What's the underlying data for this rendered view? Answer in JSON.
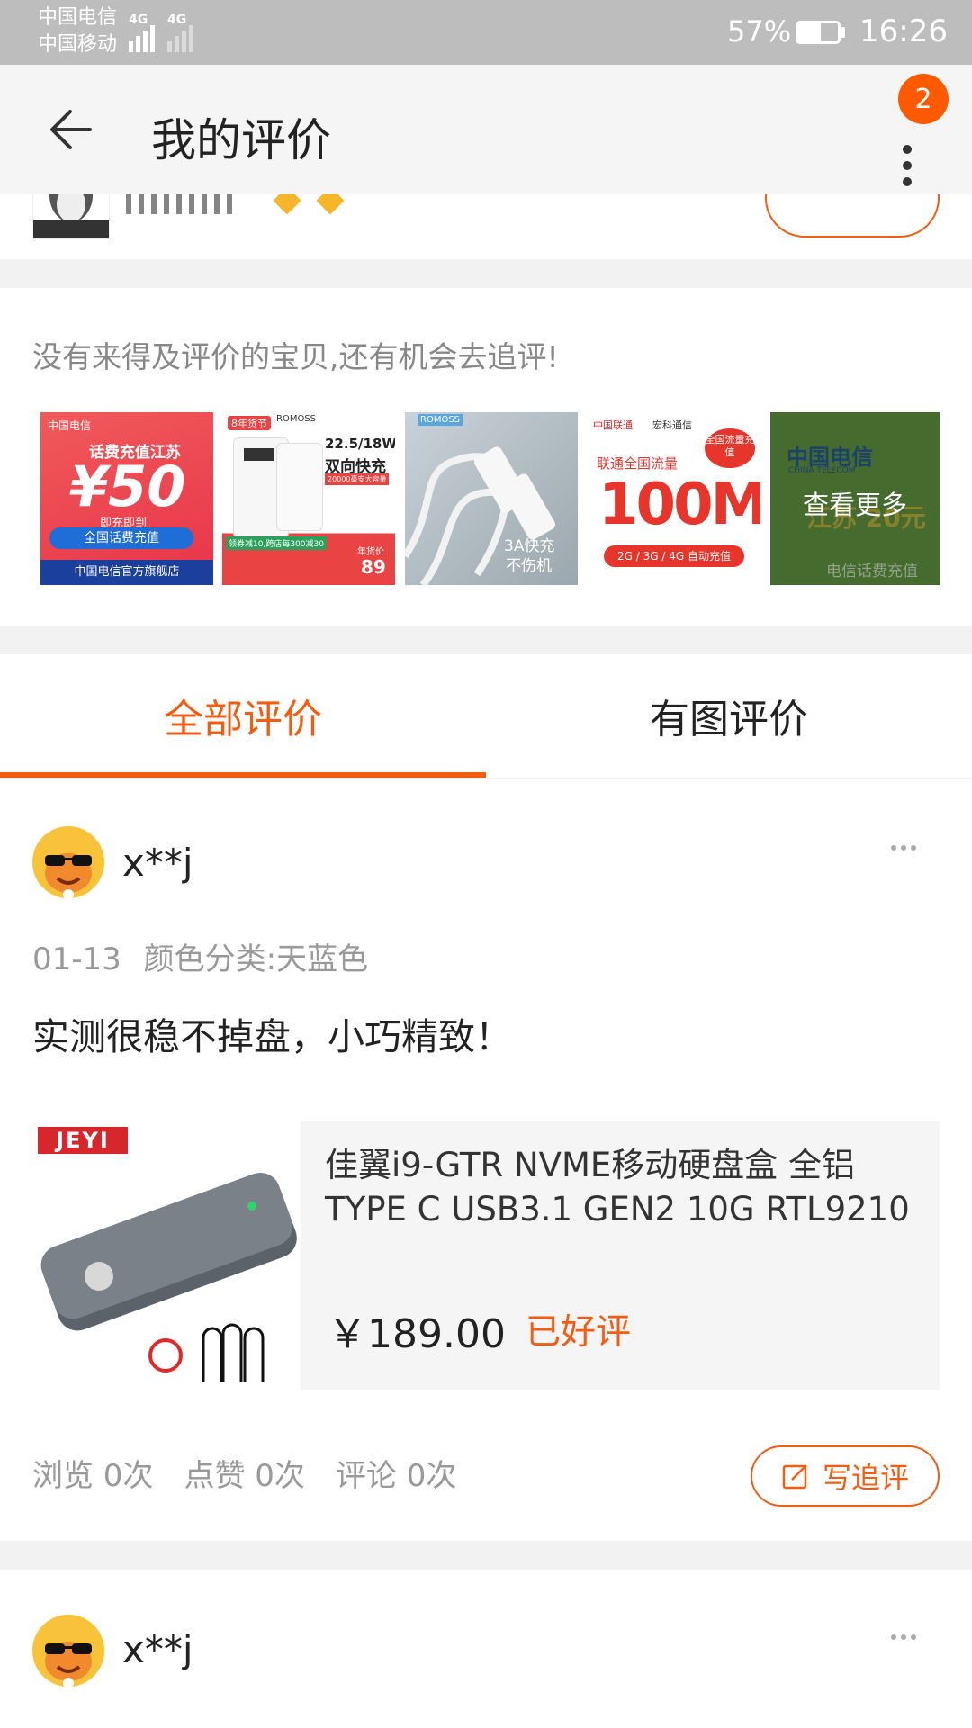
{
  "status_bar": {
    "carrier_1": "中国电信",
    "carrier_2": "中国移动",
    "network_1": "4G",
    "network_2": "4G",
    "battery": "57%",
    "battery_level": 0.57,
    "time": "16:26"
  },
  "header": {
    "title": "我的评价",
    "badge_count": "2"
  },
  "followup_section": {
    "prompt": "没有来得及评价的宝贝,还有机会去追评!",
    "view_more": "查看更多",
    "thumbnails": [
      {
        "lines": [
          "中国电信",
          "话费充值江苏",
          "¥50",
          "即充即到",
          "全国话费充值",
          "中国电信官方旗舰店"
        ]
      },
      {
        "lines": [
          "ROMOSS",
          "8年货节",
          "22.5/18W",
          "双向快充",
          "20000毫安大容量",
          "领券减10,跨店每300减30",
          "年货价",
          "89"
        ]
      },
      {
        "lines": [
          "ROMOSS",
          "3A快充",
          "不伤机"
        ]
      },
      {
        "lines": [
          "中国联通",
          "宏科通信",
          "全国流量充值",
          "联通全国流量",
          "100M",
          "2G / 3G / 4G 自动充值"
        ]
      },
      {
        "lines": [
          "中国电信",
          "CHINA TELECOM",
          "江苏 20元",
          "电信话费充值"
        ]
      }
    ]
  },
  "tabs": [
    {
      "label": "全部评价",
      "active": true
    },
    {
      "label": "有图评价",
      "active": false
    }
  ],
  "reviews": [
    {
      "user": "x**j",
      "date": "01-13",
      "sku": "颜色分类:天蓝色",
      "text": "实测很稳不掉盘，小巧精致！",
      "product": {
        "brand": "JEYI",
        "name_line1": "佳翼i9-GTR NVME移动硬盘盒 全铝",
        "name_line2": "TYPE C USB3.1 GEN2 10G RTL9210",
        "price": "￥189.00",
        "status": "已好评"
      },
      "stats": [
        "浏览 0次",
        "点赞 0次",
        "评论 0次"
      ],
      "followup_label": "写追评"
    },
    {
      "user": "x**j"
    }
  ],
  "colors": {
    "accent": "#f25d12",
    "status_bar": "#bdbdbd",
    "header": "#f5f5f5",
    "background": "#f2f2f2"
  },
  "icons": [
    "back-arrow-icon",
    "more-vertical-icon",
    "more-horizontal-icon",
    "edit-icon",
    "signal-icon",
    "battery-icon"
  ]
}
